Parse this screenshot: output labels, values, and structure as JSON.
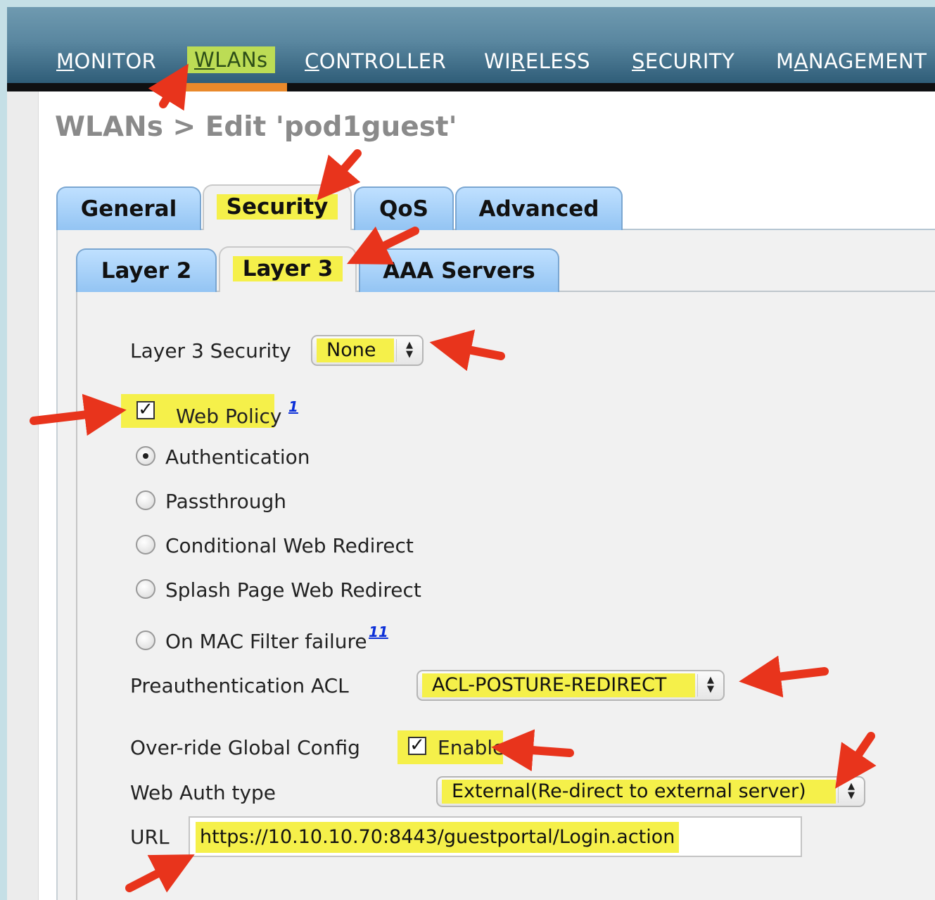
{
  "nav": {
    "items": [
      {
        "label": "MONITOR",
        "ul": "M",
        "rest": "ONITOR",
        "pre": ""
      },
      {
        "label": "WLANs",
        "ul": "W",
        "rest": "LANs",
        "pre": ""
      },
      {
        "label": "CONTROLLER",
        "ul": "C",
        "rest": "ONTROLLER",
        "pre": ""
      },
      {
        "label": "WIRELESS",
        "pre": "WI",
        "ul": "R",
        "rest": "ELESS"
      },
      {
        "label": "SECURITY",
        "ul": "S",
        "rest": "ECURITY",
        "pre": ""
      },
      {
        "label": "MANAGEMENT",
        "pre": "M",
        "ul": "A",
        "rest": "NAGEMENT"
      }
    ],
    "active": "WLANs"
  },
  "page": {
    "title": "WLANs > Edit   'pod1guest'"
  },
  "tabs": [
    "General",
    "Security",
    "QoS",
    "Advanced"
  ],
  "subtabs": [
    "Layer 2",
    "Layer 3",
    "AAA Servers"
  ],
  "form": {
    "layer3_security_label": "Layer 3 Security",
    "layer3_security_value": "None",
    "web_policy_label": "Web Policy",
    "web_policy_note": "1",
    "web_policy_checked": true,
    "radio_options": [
      "Authentication",
      "Passthrough",
      "Conditional Web Redirect",
      "Splash Page Web Redirect",
      "On MAC Filter failure"
    ],
    "radio_selected": "Authentication",
    "mac_filter_note": "11",
    "preauth_acl_label": "Preauthentication ACL",
    "preauth_acl_value": "ACL-POSTURE-REDIRECT",
    "override_label": "Over-ride Global Config",
    "override_checkbox_label": "Enable",
    "web_auth_type_label": "Web Auth type",
    "web_auth_type_value": "External(Re-direct to external server)",
    "url_label": "URL",
    "url_value": "https://10.10.10.70:8443/guestportal/Login.action"
  },
  "colors": {
    "highlight": "#f5f04a",
    "arrow": "#e8341c",
    "tab_blue": "#93c4f3",
    "nav_active": "#bcdc55"
  }
}
